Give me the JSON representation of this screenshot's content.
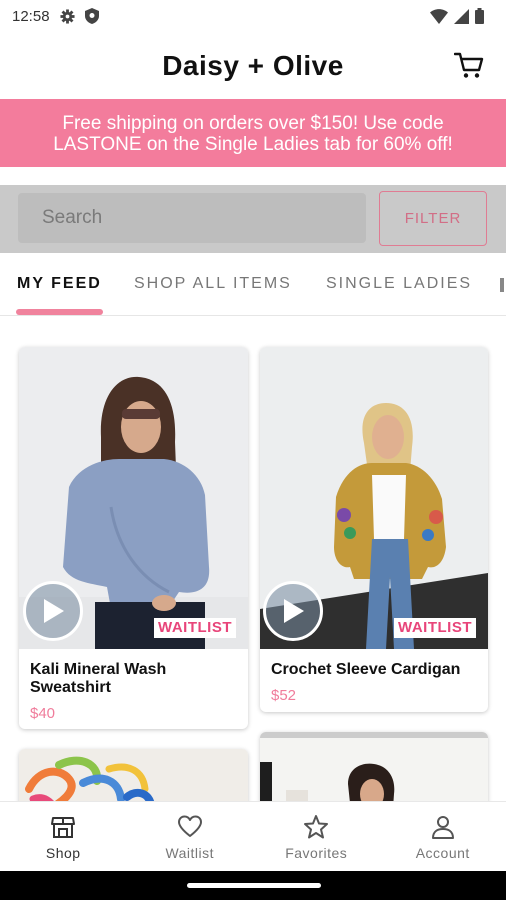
{
  "status_bar": {
    "time": "12:58",
    "left_icons": [
      "gear-icon",
      "shield-icon"
    ],
    "right_icons": [
      "wifi-icon",
      "signal-icon",
      "battery-icon"
    ]
  },
  "header": {
    "title": "Daisy + Olive",
    "cart_icon": "cart-icon"
  },
  "promo": {
    "line1": "Free shipping on orders over $150! Use code",
    "line2": "LASTONE on the Single Ladies tab for 60% off!"
  },
  "search": {
    "placeholder": "Search",
    "filter_label": "FILTER"
  },
  "tabs": [
    "MY FEED",
    "SHOP ALL ITEMS",
    "SINGLE LADIES"
  ],
  "products": [
    {
      "name_line1": "Kali Mineral Wash",
      "name_line2": "Sweatshirt",
      "price": "$40",
      "badge": "WAITLIST"
    },
    {
      "name_line1": "Crochet Sleeve Cardigan",
      "name_line2": "",
      "price": "$52",
      "badge": "WAITLIST"
    }
  ],
  "bottom_nav": [
    {
      "label": "Shop",
      "icon": "shop-icon"
    },
    {
      "label": "Waitlist",
      "icon": "heart-icon"
    },
    {
      "label": "Favorites",
      "icon": "star-icon"
    },
    {
      "label": "Account",
      "icon": "account-icon"
    }
  ],
  "colors": {
    "accent_pink": "#f37c9c",
    "waitlist_pink": "#e8457a",
    "price_pink": "#f07c9b"
  }
}
